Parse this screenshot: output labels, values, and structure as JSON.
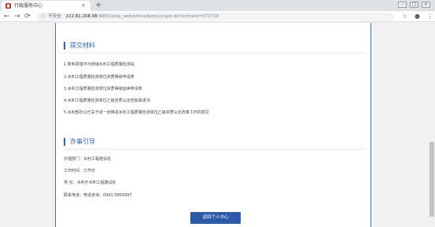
{
  "browser": {
    "tab_title": "行政服务中心",
    "tab_close": "×",
    "new_tab": "+",
    "back": "←",
    "forward": "→",
    "reload": "⟳",
    "security_icon": "ⓘ",
    "security_label": "不安全",
    "url_host": "222.82.208.98",
    "url_path": ":9093/szsp_web/onlineApply/ycgzs.do?onlineId=572719",
    "star": "☆",
    "account": "●",
    "menu": "⋮",
    "win_min": "–",
    "win_max": "□",
    "win_close": "×"
  },
  "materials": {
    "heading": "提交材料",
    "items": [
      "1.新和县猎平河流域水利工程质量检测站",
      "2.水利工程质量检测单位资质等级申请表",
      "3.水利工程质量检测单位资质等级延续申请表",
      "4.水利工程质量检测单位乙级资质认定告知承诺书",
      "5.水利部办公厅关于进一步推进水利工程质量检测单位乙级资质认定改革工作的意见"
    ]
  },
  "guide": {
    "heading": "办事引导",
    "department": "办理部门：水利工程建设处",
    "hours": "工作时间：工作日",
    "address": "地 址：水利厅水利工程建设处",
    "phone": "联系电话：电话咨询：0991-5850997"
  },
  "return_button": "返回个人中心"
}
